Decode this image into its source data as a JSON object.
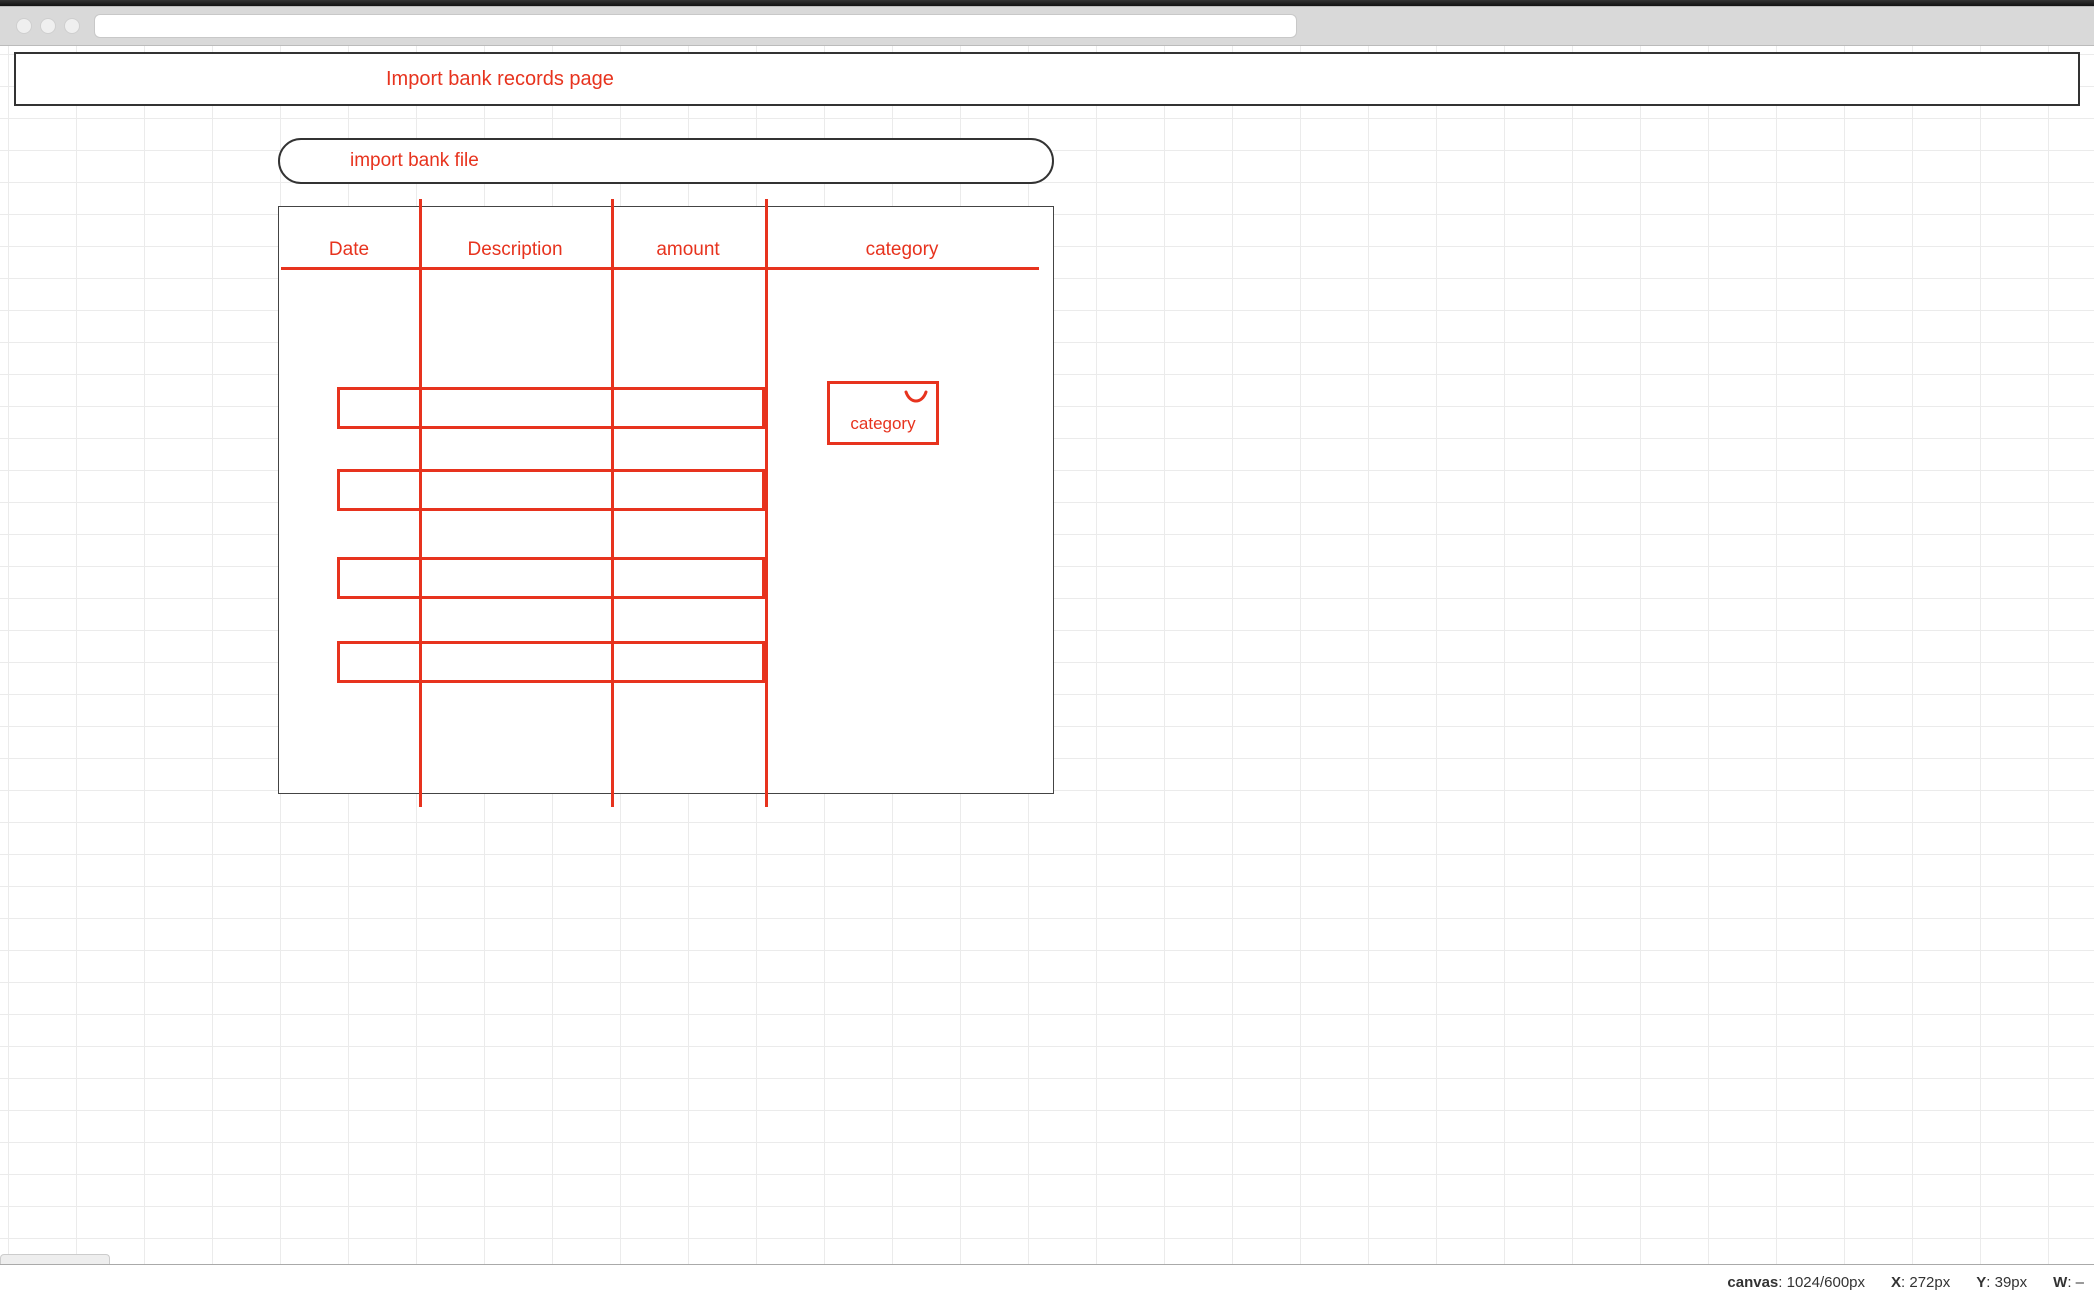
{
  "page": {
    "title": "Import bank records page",
    "import_button_label": "import bank file"
  },
  "table": {
    "headers": {
      "date": "Date",
      "description": "Description",
      "amount": "amount",
      "category": "category"
    },
    "category_dropdown_label": "category"
  },
  "statusbar": {
    "canvas_label": "canvas",
    "canvas_value": "1024/600px",
    "x_label": "X",
    "x_value": "272px",
    "y_label": "Y",
    "y_value": "39px",
    "w_label": "W",
    "w_value": "–"
  }
}
